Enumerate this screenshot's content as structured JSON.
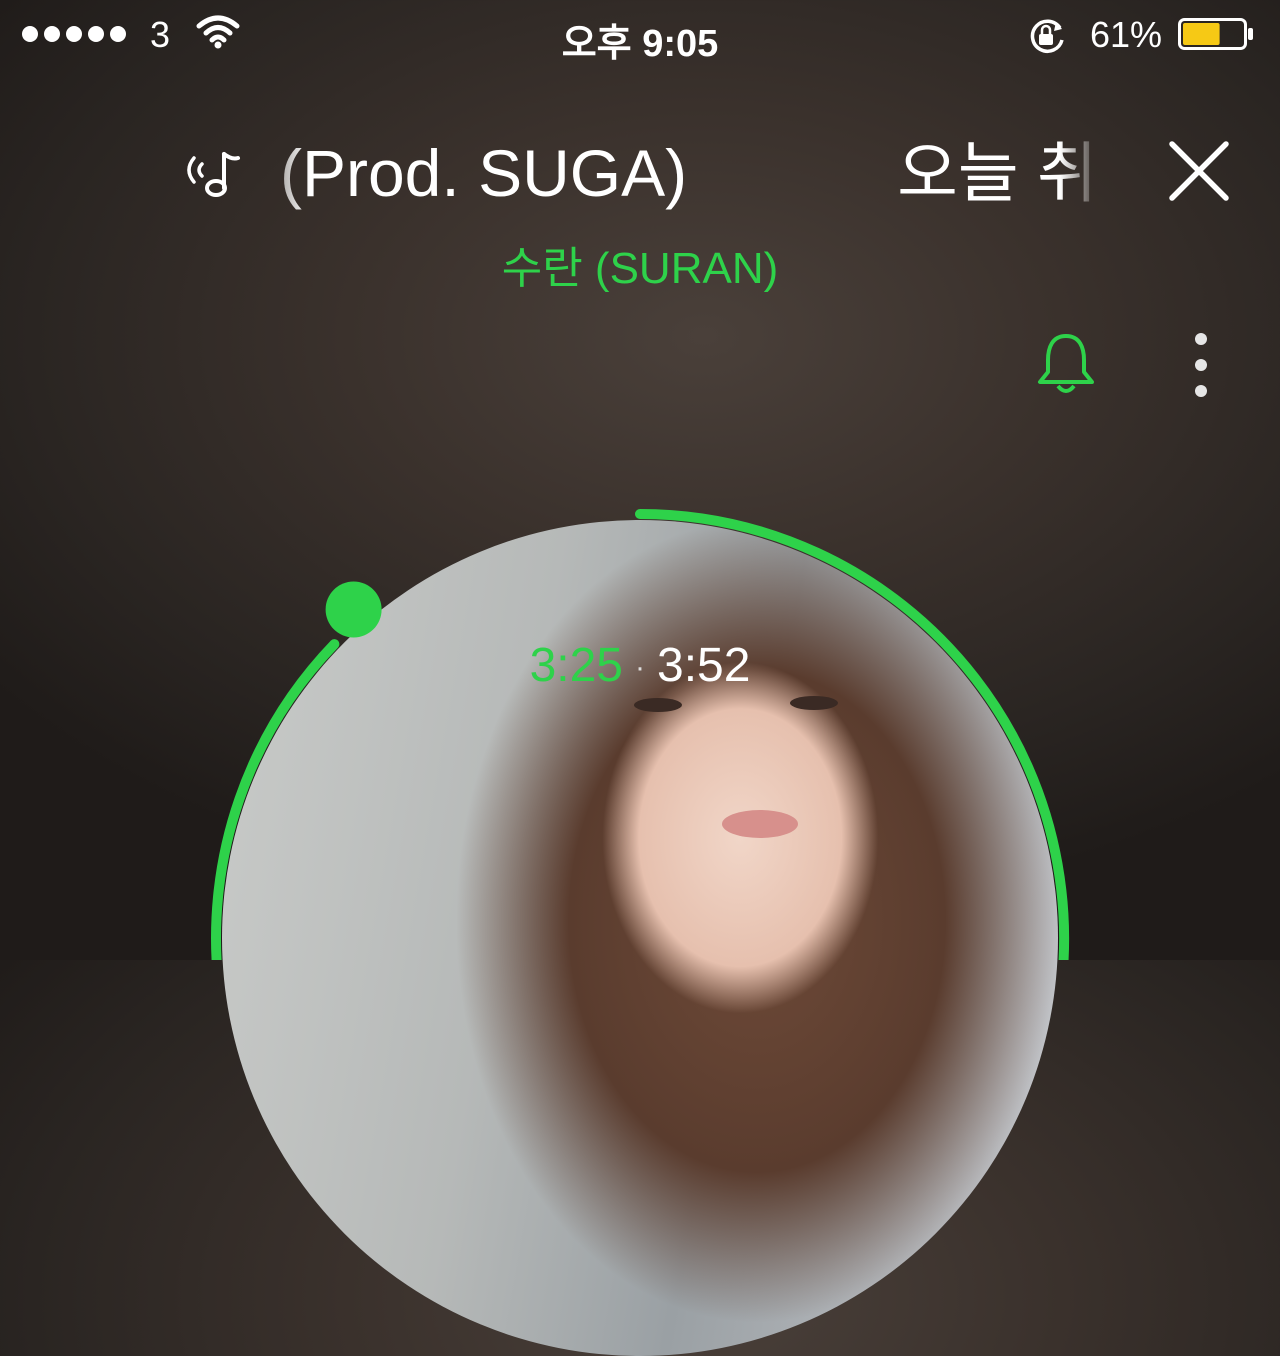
{
  "status_bar": {
    "carrier": "3",
    "time": "오후 9:05",
    "battery_percent": "61%",
    "battery_level": 0.61,
    "battery_color": "#f6c915",
    "icons": [
      "signal-dots-icon",
      "wifi-icon",
      "rotation-lock-icon",
      "battery-icon"
    ]
  },
  "header": {
    "title_fragments": [
      "(Prod. SUGA)",
      "오늘 취"
    ],
    "artist": "수란 (SURAN)",
    "icons": [
      "hearing-music-icon",
      "close-icon",
      "bell-icon",
      "more-vertical-icon"
    ]
  },
  "player": {
    "elapsed": "3:25",
    "separator": "·",
    "total": "3:52",
    "progress_fraction": 0.883
  },
  "colors": {
    "accent": "#2ed24a",
    "text": "#ffffff"
  }
}
